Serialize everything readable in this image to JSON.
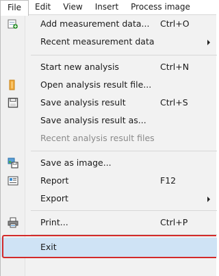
{
  "menubar": {
    "items": [
      "File",
      "Edit",
      "View",
      "Insert",
      "Process image"
    ]
  },
  "menu": {
    "items": [
      {
        "label": "Add measurement data...",
        "shortcut": "Ctrl+O",
        "icon": "add-data-icon"
      },
      {
        "label": "Recent measurement data",
        "submenu": true
      },
      {
        "label": "Start new analysis",
        "shortcut": "Ctrl+N"
      },
      {
        "label": "Open analysis result file...",
        "icon": "folder-icon"
      },
      {
        "label": "Save analysis result",
        "shortcut": "Ctrl+S",
        "icon": "save-icon"
      },
      {
        "label": "Save analysis result as..."
      },
      {
        "label": "Recent analysis result files",
        "disabled": true
      },
      {
        "label": "Save as image...",
        "icon": "save-image-icon"
      },
      {
        "label": "Report",
        "shortcut": "F12",
        "icon": "report-icon"
      },
      {
        "label": "Export",
        "submenu": true
      },
      {
        "label": "Print...",
        "shortcut": "Ctrl+P",
        "icon": "print-icon"
      },
      {
        "label": "Exit",
        "highlighted": true
      }
    ]
  },
  "colors": {
    "highlight": "#cfe3f5",
    "frame": "#d22a2a",
    "disabled_text": "#8a8a8a"
  }
}
